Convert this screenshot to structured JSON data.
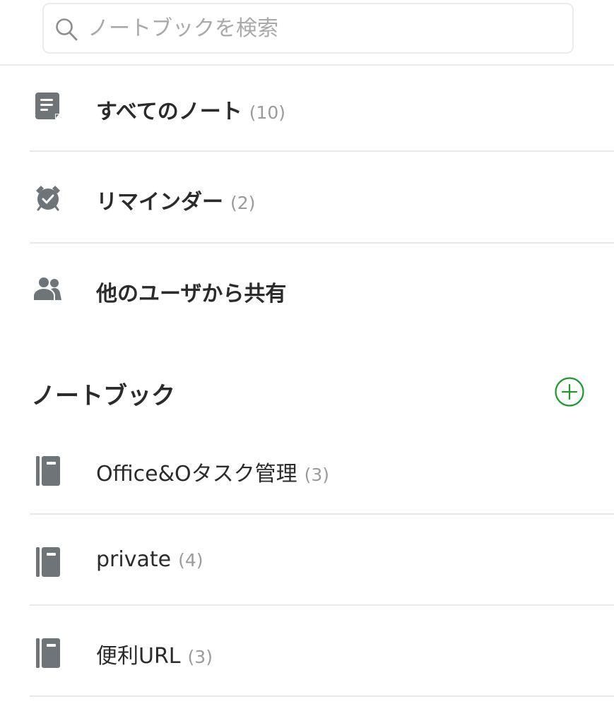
{
  "search": {
    "placeholder": "ノートブックを検索",
    "value": ""
  },
  "shortcuts": [
    {
      "label": "すべてのノート",
      "count": "(10)",
      "icon": "note-icon"
    },
    {
      "label": "リマインダー",
      "count": "(2)",
      "icon": "alarm-clock-icon"
    },
    {
      "label": "他のユーザから共有",
      "count": "",
      "icon": "users-icon"
    }
  ],
  "notebooks_section": {
    "title": "ノートブック",
    "add_icon": "plus-circle-icon"
  },
  "notebooks": [
    {
      "label": "Office&Oタスク管理",
      "count": "(3)",
      "icon": "notebook-icon"
    },
    {
      "label": "private",
      "count": "(4)",
      "icon": "notebook-icon"
    },
    {
      "label": "便利URL",
      "count": "(3)",
      "icon": "notebook-icon"
    }
  ],
  "colors": {
    "icon_gray": "#6f7479",
    "accent_green": "#1a9a2e",
    "divider": "#e8e8e8",
    "count_gray": "#9b9b9b"
  }
}
